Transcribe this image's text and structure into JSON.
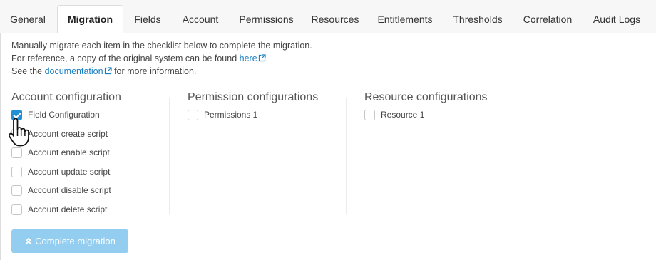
{
  "tabs": [
    {
      "label": "General"
    },
    {
      "label": "Migration",
      "active": true
    },
    {
      "label": "Fields"
    },
    {
      "label": "Account"
    },
    {
      "label": "Permissions"
    },
    {
      "label": "Resources"
    },
    {
      "label": "Entitlements"
    },
    {
      "label": "Thresholds"
    },
    {
      "label": "Correlation"
    },
    {
      "label": "Audit Logs"
    }
  ],
  "intro": {
    "line1": "Manually migrate each item in the checklist below to complete the migration.",
    "line2_prefix": "For reference, a copy of the original system can be found ",
    "line2_link": "here",
    "line2_suffix": ".",
    "line3_prefix": "See the ",
    "line3_link": "documentation",
    "line3_suffix": " for more information.",
    "link_color": "#1a7fc1",
    "external_icon": "external-link-icon"
  },
  "columns": {
    "account": {
      "title": "Account configuration",
      "items": [
        {
          "label": "Field Configuration",
          "checked": true
        },
        {
          "label": "Account create script",
          "checked": false
        },
        {
          "label": "Account enable script",
          "checked": false
        },
        {
          "label": "Account update script",
          "checked": false
        },
        {
          "label": "Account disable script",
          "checked": false
        },
        {
          "label": "Account delete script",
          "checked": false
        }
      ]
    },
    "permission": {
      "title": "Permission configurations",
      "items": [
        {
          "label": "Permissions 1",
          "checked": false
        }
      ]
    },
    "resource": {
      "title": "Resource configurations",
      "items": [
        {
          "label": "Resource 1",
          "checked": false
        }
      ]
    }
  },
  "complete_button": {
    "label": "Complete migration",
    "icon": "double-chevron-up-icon",
    "disabled": true,
    "color": "#93cef0"
  },
  "colors": {
    "accent": "#1f8fd6"
  },
  "cursor_icon": "hand-pointer-icon"
}
